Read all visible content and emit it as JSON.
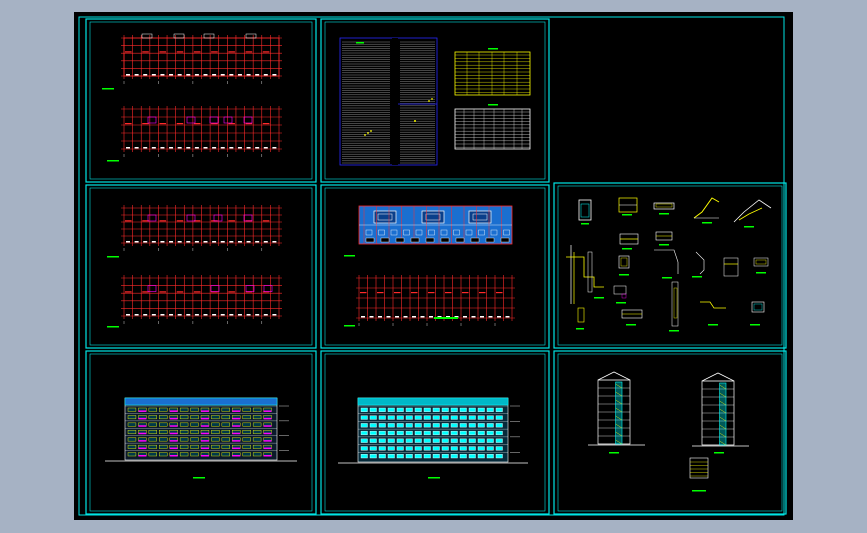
{
  "colors": {
    "background": "#a6b2c4",
    "canvas": "#000000",
    "frame": "#00e5e5",
    "plan_lines": "#ff2a2a",
    "title_bar": "#00ff00",
    "table_yellow": "#ffff00",
    "schedule_blue": "#2a2aff",
    "elevation_cyan": "#00ffff",
    "accent_magenta": "#ff00ff"
  },
  "sheets": [
    {
      "key": "floor-plans-a",
      "content": "floor-plans"
    },
    {
      "key": "schedules",
      "content": "tables"
    },
    {
      "key": "empty",
      "content": "none"
    },
    {
      "key": "floor-plans-b",
      "content": "floor-plans"
    },
    {
      "key": "roof-and-ground-plans",
      "content": "floor-plans"
    },
    {
      "key": "details",
      "content": "details"
    },
    {
      "key": "front-elevation",
      "content": "elevation"
    },
    {
      "key": "rear-elevation",
      "content": "elevation"
    },
    {
      "key": "sections",
      "content": "sections"
    }
  ]
}
